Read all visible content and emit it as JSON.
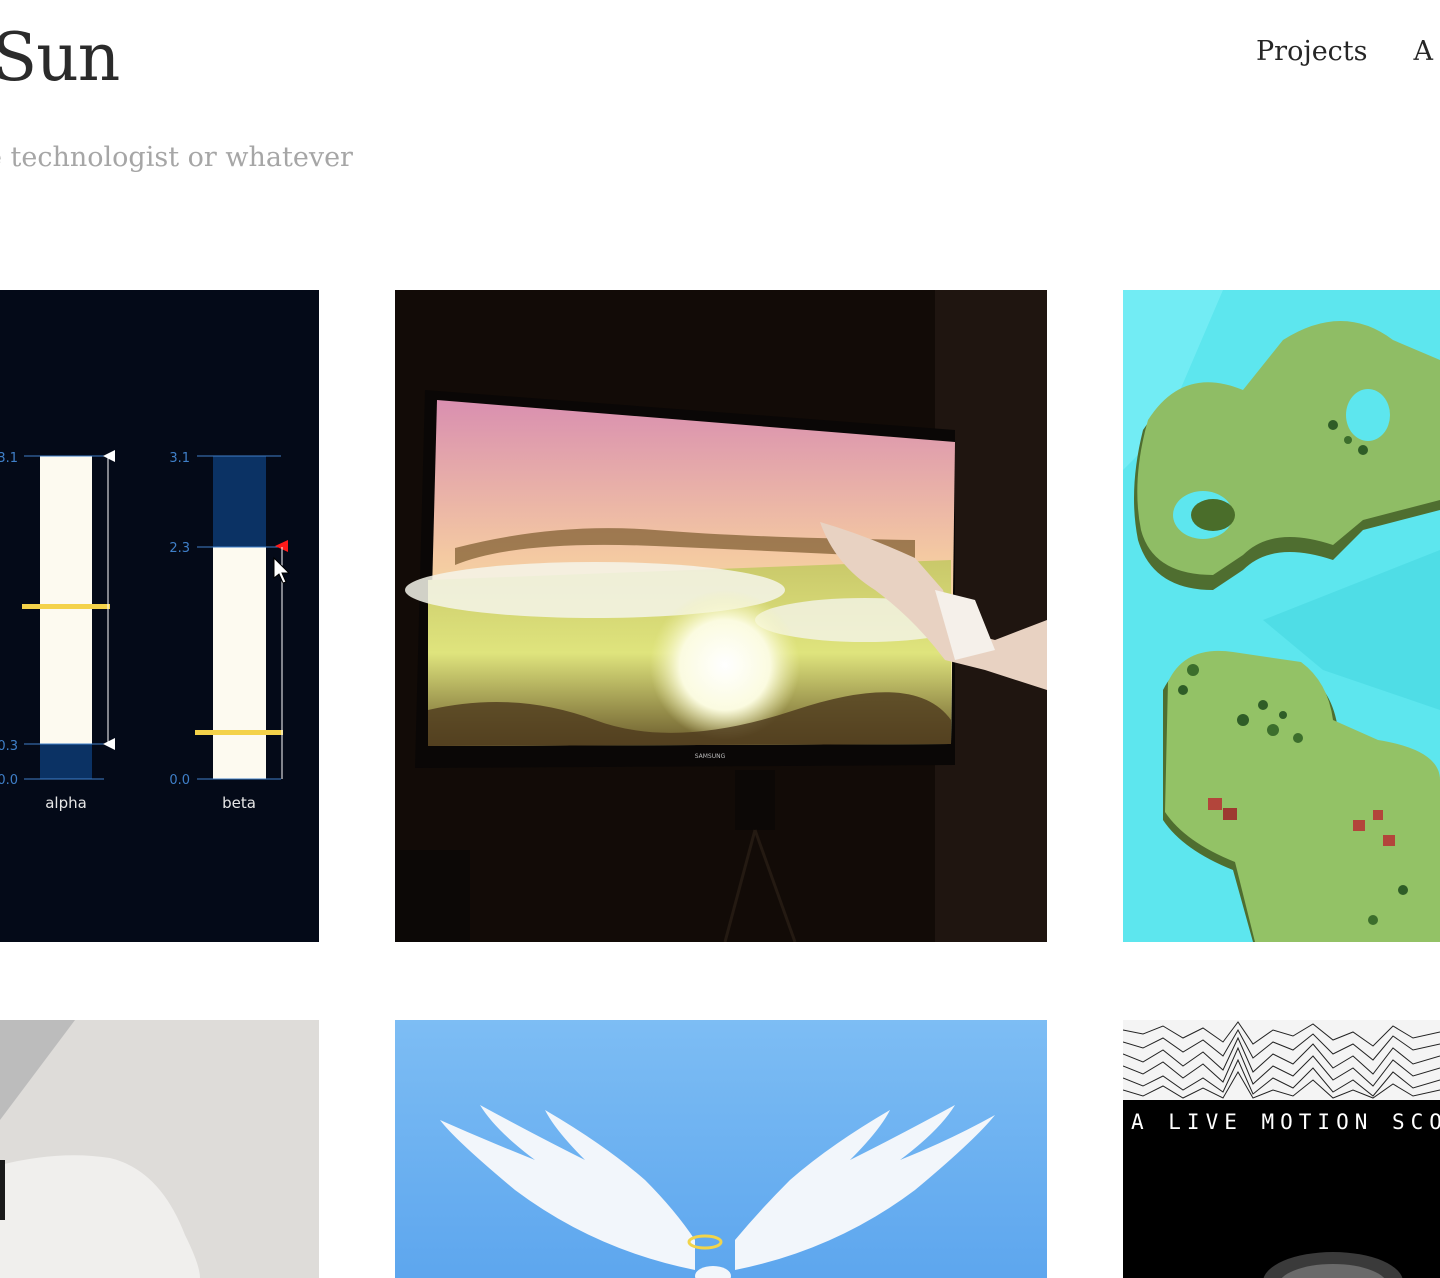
{
  "header": {
    "title": "Sun",
    "tagline": "e technologist or whatever"
  },
  "nav": {
    "items": [
      "Projects",
      "A"
    ]
  },
  "tiles": {
    "eeg": {
      "bars": [
        {
          "label": "alpha",
          "ticks": [
            "3.1",
            "0.3",
            "0.0"
          ],
          "range_high": 3.1,
          "range_low": 0.3,
          "marker": 1.8
        },
        {
          "label": "beta",
          "ticks": [
            "3.1",
            "2.3",
            "0.0"
          ],
          "range_high": 2.3,
          "range_low": 0.0,
          "marker": 0.5
        }
      ]
    },
    "motion_score": {
      "caption": "A LIVE MOTION SCO"
    }
  },
  "colors": {
    "title": "#2b2b2b",
    "tagline": "#a6a6a6",
    "nav": "#262626",
    "eeg_bg": "#040a18",
    "eeg_fill": "#fdfaf0",
    "eeg_dark": "#0b3264",
    "eeg_marker": "#f4d24a",
    "sky": "#6fb3f2",
    "water": "#5de6ee",
    "island": "#8fbd65"
  }
}
